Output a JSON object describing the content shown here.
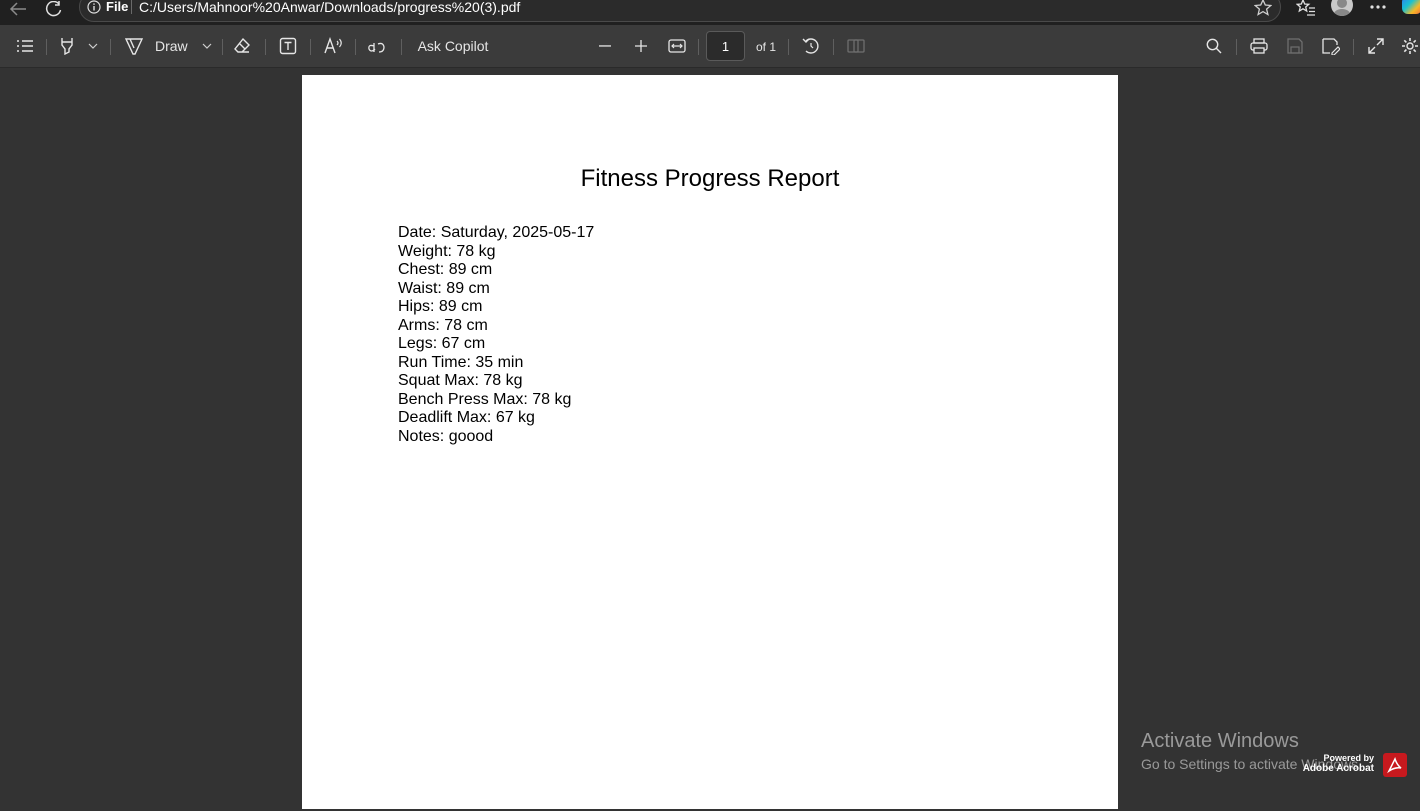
{
  "address_bar": {
    "scheme_label": "File",
    "url": "C:/Users/Mahnoor%20Anwar/Downloads/progress%20(3).pdf"
  },
  "toolbar": {
    "draw_label": "Draw",
    "ask_copilot_label": "Ask Copilot",
    "page_number": "1",
    "page_total_label": "of 1"
  },
  "document": {
    "title": "Fitness Progress Report",
    "lines": [
      "Date: Saturday, 2025-05-17",
      "Weight: 78 kg",
      "Chest: 89 cm",
      "Waist: 89 cm",
      "Hips: 89 cm",
      "Arms: 78 cm",
      "Legs: 67 cm",
      "Run Time: 35 min",
      "Squat Max: 78 kg",
      "Bench Press Max: 78 kg",
      "Deadlift Max: 67 kg",
      "Notes: goood"
    ]
  },
  "watermark": {
    "title": "Activate Windows",
    "subtitle": "Go to Settings to activate Windows."
  },
  "powered_by": {
    "line1": "Powered by",
    "line2": "Adobe Acrobat"
  },
  "colors": {
    "toolbar_bg": "#3b3b3b",
    "viewer_bg": "#333333",
    "address_bg": "#202020",
    "acrobat_red": "#c7191e"
  }
}
